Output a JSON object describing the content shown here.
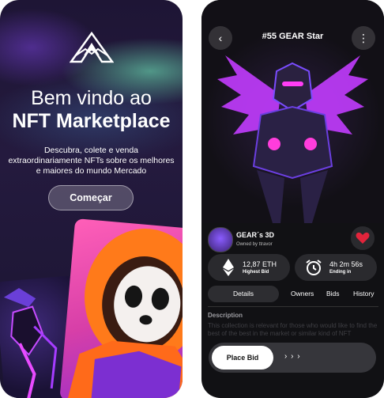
{
  "welcome": {
    "line1": "Bem vindo ao",
    "line2": "NFT Marketplace",
    "description": "Descubra, colete e venda extraordinariamente NFTs sobre os melhores e maiores do mundo Mercado",
    "cta": "Começar"
  },
  "detail": {
    "title": "#55 GEAR Star",
    "owner": {
      "name": "GEAR´s 3D",
      "owned_by": "Owned by ttravor"
    },
    "stats": [
      {
        "value": "12,87 ETH",
        "label": "Highest Bid",
        "icon": "ethereum-icon"
      },
      {
        "value": "4h 2m 56s",
        "label": "Ending in",
        "icon": "alarm-clock-icon"
      }
    ],
    "tabs": [
      "Details",
      "Owners",
      "Bids",
      "History"
    ],
    "active_tab": "Details",
    "description_label": "Description",
    "description_text": "This collection is relevant for those who would like to find the best of the best in the market or similar kind of NFT",
    "place_bid": "Place Bid",
    "slide_arrows": "› › ›"
  },
  "colors": {
    "background": "#111114",
    "accent_heart": "#e2243b",
    "glow": "#b030ff"
  }
}
